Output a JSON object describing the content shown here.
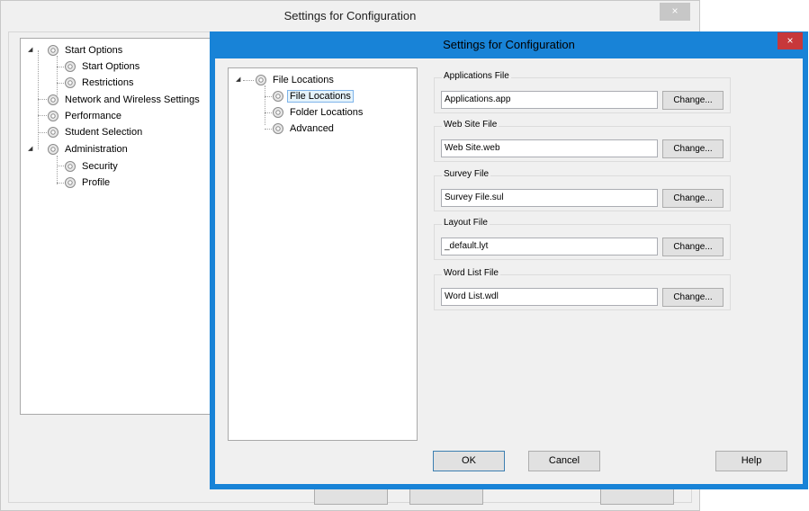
{
  "back_window": {
    "title": "Settings for Configuration",
    "close_glyph": "×",
    "tree": [
      {
        "label": "Start Options",
        "level": 0,
        "expanded": true
      },
      {
        "label": "Start Options",
        "level": 1
      },
      {
        "label": "Restrictions",
        "level": 1
      },
      {
        "label": "Network and Wireless Settings",
        "level": 0
      },
      {
        "label": "Performance",
        "level": 0
      },
      {
        "label": "Student Selection",
        "level": 0
      },
      {
        "label": "Administration",
        "level": 0,
        "expanded": true
      },
      {
        "label": "Security",
        "level": 1
      },
      {
        "label": "Profile",
        "level": 1,
        "selected": true
      }
    ]
  },
  "dialog": {
    "title": "Settings for Configuration",
    "close_glyph": "×",
    "accent_color": "#1883d7",
    "close_color": "#c7383a",
    "tree": [
      {
        "label": "File Locations",
        "level": 0,
        "expanded": true
      },
      {
        "label": "File Locations",
        "level": 1,
        "selected": true
      },
      {
        "label": "Folder Locations",
        "level": 1
      },
      {
        "label": "Advanced",
        "level": 1
      }
    ],
    "groups": [
      {
        "label": "Applications File",
        "value": "Applications.app",
        "button": "Change..."
      },
      {
        "label": "Web Site File",
        "value": "Web Site.web",
        "button": "Change..."
      },
      {
        "label": "Survey File",
        "value": "Survey File.sul",
        "button": "Change..."
      },
      {
        "label": "Layout File",
        "value": "_default.lyt",
        "button": "Change..."
      },
      {
        "label": "Word List File",
        "value": "Word List.wdl",
        "button": "Change..."
      }
    ],
    "buttons": {
      "ok": "OK",
      "cancel": "Cancel",
      "help": "Help"
    }
  },
  "icons": {
    "tree_node": "gear-icon",
    "expander": "expand-triangle-icon"
  }
}
